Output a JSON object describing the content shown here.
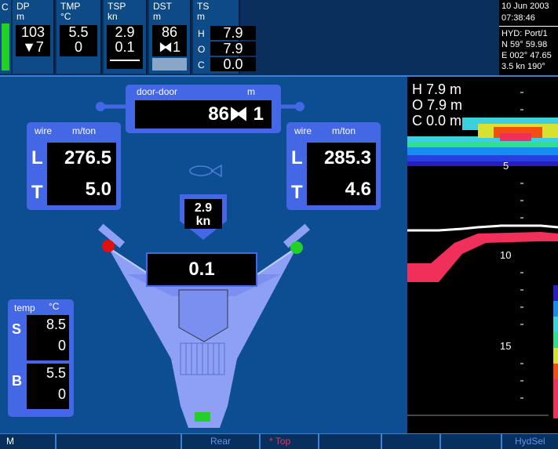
{
  "topbar": {
    "c_label": "C",
    "dp": {
      "label": "DP\nm",
      "value1": "103",
      "value2": "▼7"
    },
    "tmp": {
      "label": "TMP\n°C",
      "value1": "5.5",
      "value2": "0"
    },
    "tsp": {
      "label": "TSP\nkn",
      "value1": "2.9",
      "value2": "0.1"
    },
    "dst": {
      "label": "DST\nm",
      "value1": "86",
      "value2": "⧓1"
    },
    "ts": {
      "label": "TS\nm",
      "rows": [
        {
          "key": "H",
          "value": "7.9"
        },
        {
          "key": "O",
          "value": "7.9"
        },
        {
          "key": "C",
          "value": "0.0"
        }
      ]
    },
    "info": {
      "date": "10 Jun 2003",
      "time": "07:38:46",
      "hyd": "HYD: Port/1",
      "lat": "N  59° 59.98",
      "lon": "E 002° 47.65",
      "speed": "3.5 kn  190°"
    }
  },
  "main": {
    "door": {
      "label": "door-door",
      "unit": "m",
      "value": "86⧓ 1"
    },
    "wire_left": {
      "label": "wire",
      "unit": "m/ton",
      "L": "276.5",
      "T": "5.0"
    },
    "wire_right": {
      "label": "wire",
      "unit": "m/ton",
      "L": "285.3",
      "T": "4.6"
    },
    "row_labels": {
      "L": "L",
      "T": "T",
      "S": "S",
      "B": "B"
    },
    "speed": {
      "value": "2.9",
      "unit": "kn"
    },
    "trawl_value": "0.1",
    "temp": {
      "label": "temp",
      "unit": "°C",
      "S1": "8.5",
      "S2": "0",
      "B1": "5.5",
      "B2": "0"
    }
  },
  "sidebar": {
    "H": "H  7.9 m",
    "O": "O  7.9 m",
    "C": "C  0.0 m",
    "depth_labels": [
      "5",
      "10",
      "15"
    ]
  },
  "status": {
    "m": "M",
    "rear": "Rear",
    "top": "* Top",
    "hydsel": "HydSel"
  },
  "colors": {
    "accent": "#4467e6",
    "panel": "#0d4d92",
    "port_light": "#e01010",
    "starboard_light": "#22d02a",
    "echo_red": "#f0305a"
  }
}
